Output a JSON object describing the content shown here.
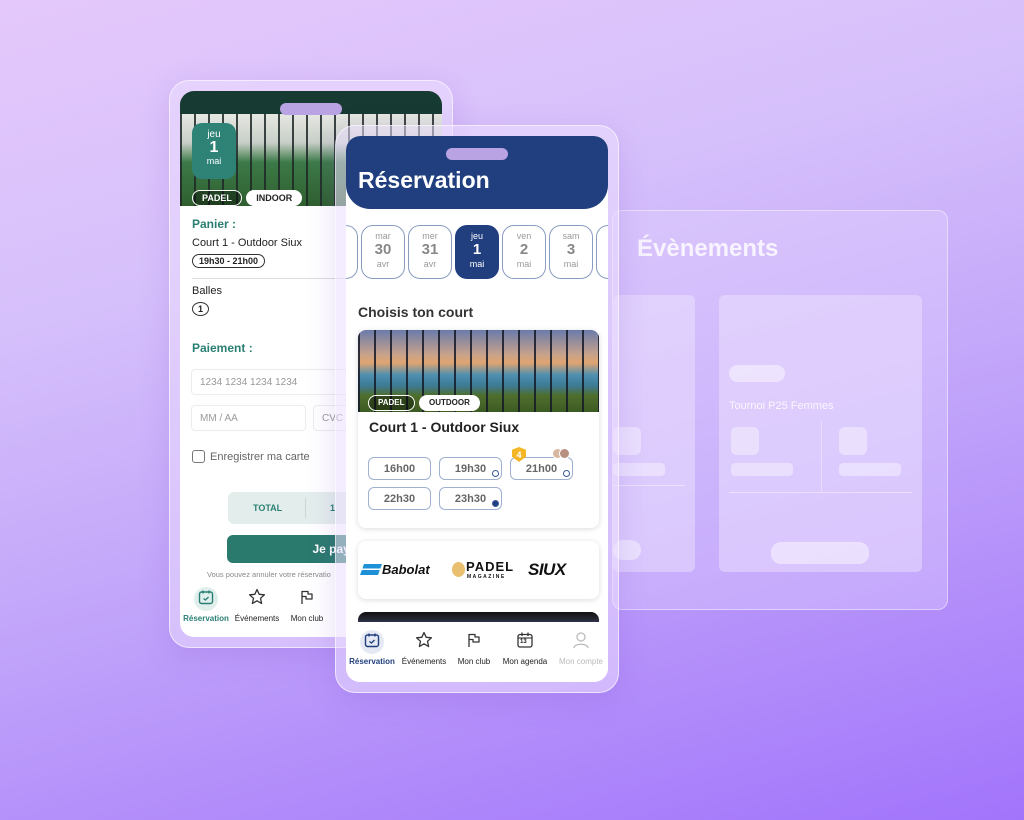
{
  "colors": {
    "primary_blue": "#213f7f",
    "teal": "#2a7f73",
    "badge_yellow": "#f4b624",
    "background_start": "#e4c8fb",
    "background_end": "#a274fb"
  },
  "events_panel": {
    "title": "Évènements",
    "card_title": "Tournoi P25 Femmes"
  },
  "left_phone": {
    "date_badge": {
      "day": "jeu",
      "num": "1",
      "month": "mai"
    },
    "tags": [
      "PADEL",
      "INDOOR"
    ],
    "cart_label": "Panier :",
    "court_name": "Court 1 - Outdoor Siux",
    "time_range": "19h30 - 21h00",
    "balls_label": "Balles",
    "balls_qty": "1",
    "payment_label": "Paiement :",
    "card_number_placeholder": "1234 1234 1234 1234",
    "expiry_placeholder": "MM / AA",
    "cvc_placeholder": "CVC",
    "save_card_label": "Enregistrer ma carte",
    "total_label": "TOTAL",
    "total_value": "1",
    "pay_button": "Je paye",
    "cancel_note": "Vous pouvez annuler votre réservatio",
    "nav": [
      {
        "label": "Réservation",
        "icon": "calendar-check-icon",
        "active": true
      },
      {
        "label": "Événements",
        "icon": "star-icon",
        "active": false
      },
      {
        "label": "Mon club",
        "icon": "flag-icon",
        "active": false
      }
    ]
  },
  "front_phone": {
    "title": "Réservation",
    "dates": [
      {
        "day": "mar",
        "num": "30",
        "month": "avr",
        "active": false
      },
      {
        "day": "mer",
        "num": "31",
        "month": "avr",
        "active": false
      },
      {
        "day": "jeu",
        "num": "1",
        "month": "mai",
        "active": true
      },
      {
        "day": "ven",
        "num": "2",
        "month": "mai",
        "active": false
      },
      {
        "day": "sam",
        "num": "3",
        "month": "mai",
        "active": false
      }
    ],
    "section_title": "Choisis ton court",
    "court": {
      "tags": [
        "PADEL",
        "OUTDOOR"
      ],
      "name": "Court 1 - Outdoor Siux",
      "slots": [
        {
          "time": "16h00",
          "clock": "none"
        },
        {
          "time": "19h30",
          "clock": "outline"
        },
        {
          "time": "21h00",
          "clock": "outline",
          "badge": "4",
          "avatars": 2
        },
        {
          "time": "22h30",
          "clock": "none"
        },
        {
          "time": "23h30",
          "clock": "filled"
        }
      ]
    },
    "sponsors": [
      "Babolat",
      "PADEL",
      "MAGAZINE",
      "SIUX"
    ],
    "nav": [
      {
        "label": "Réservation",
        "icon": "calendar-check-icon",
        "active": true
      },
      {
        "label": "Événements",
        "icon": "star-icon",
        "active": false
      },
      {
        "label": "Mon club",
        "icon": "flag-icon",
        "active": false
      },
      {
        "label": "Mon agenda",
        "icon": "calendar-13-icon",
        "active": false,
        "icon_text": "13"
      },
      {
        "label": "Mon compte",
        "icon": "user-icon",
        "active": false,
        "dim": true
      }
    ]
  }
}
